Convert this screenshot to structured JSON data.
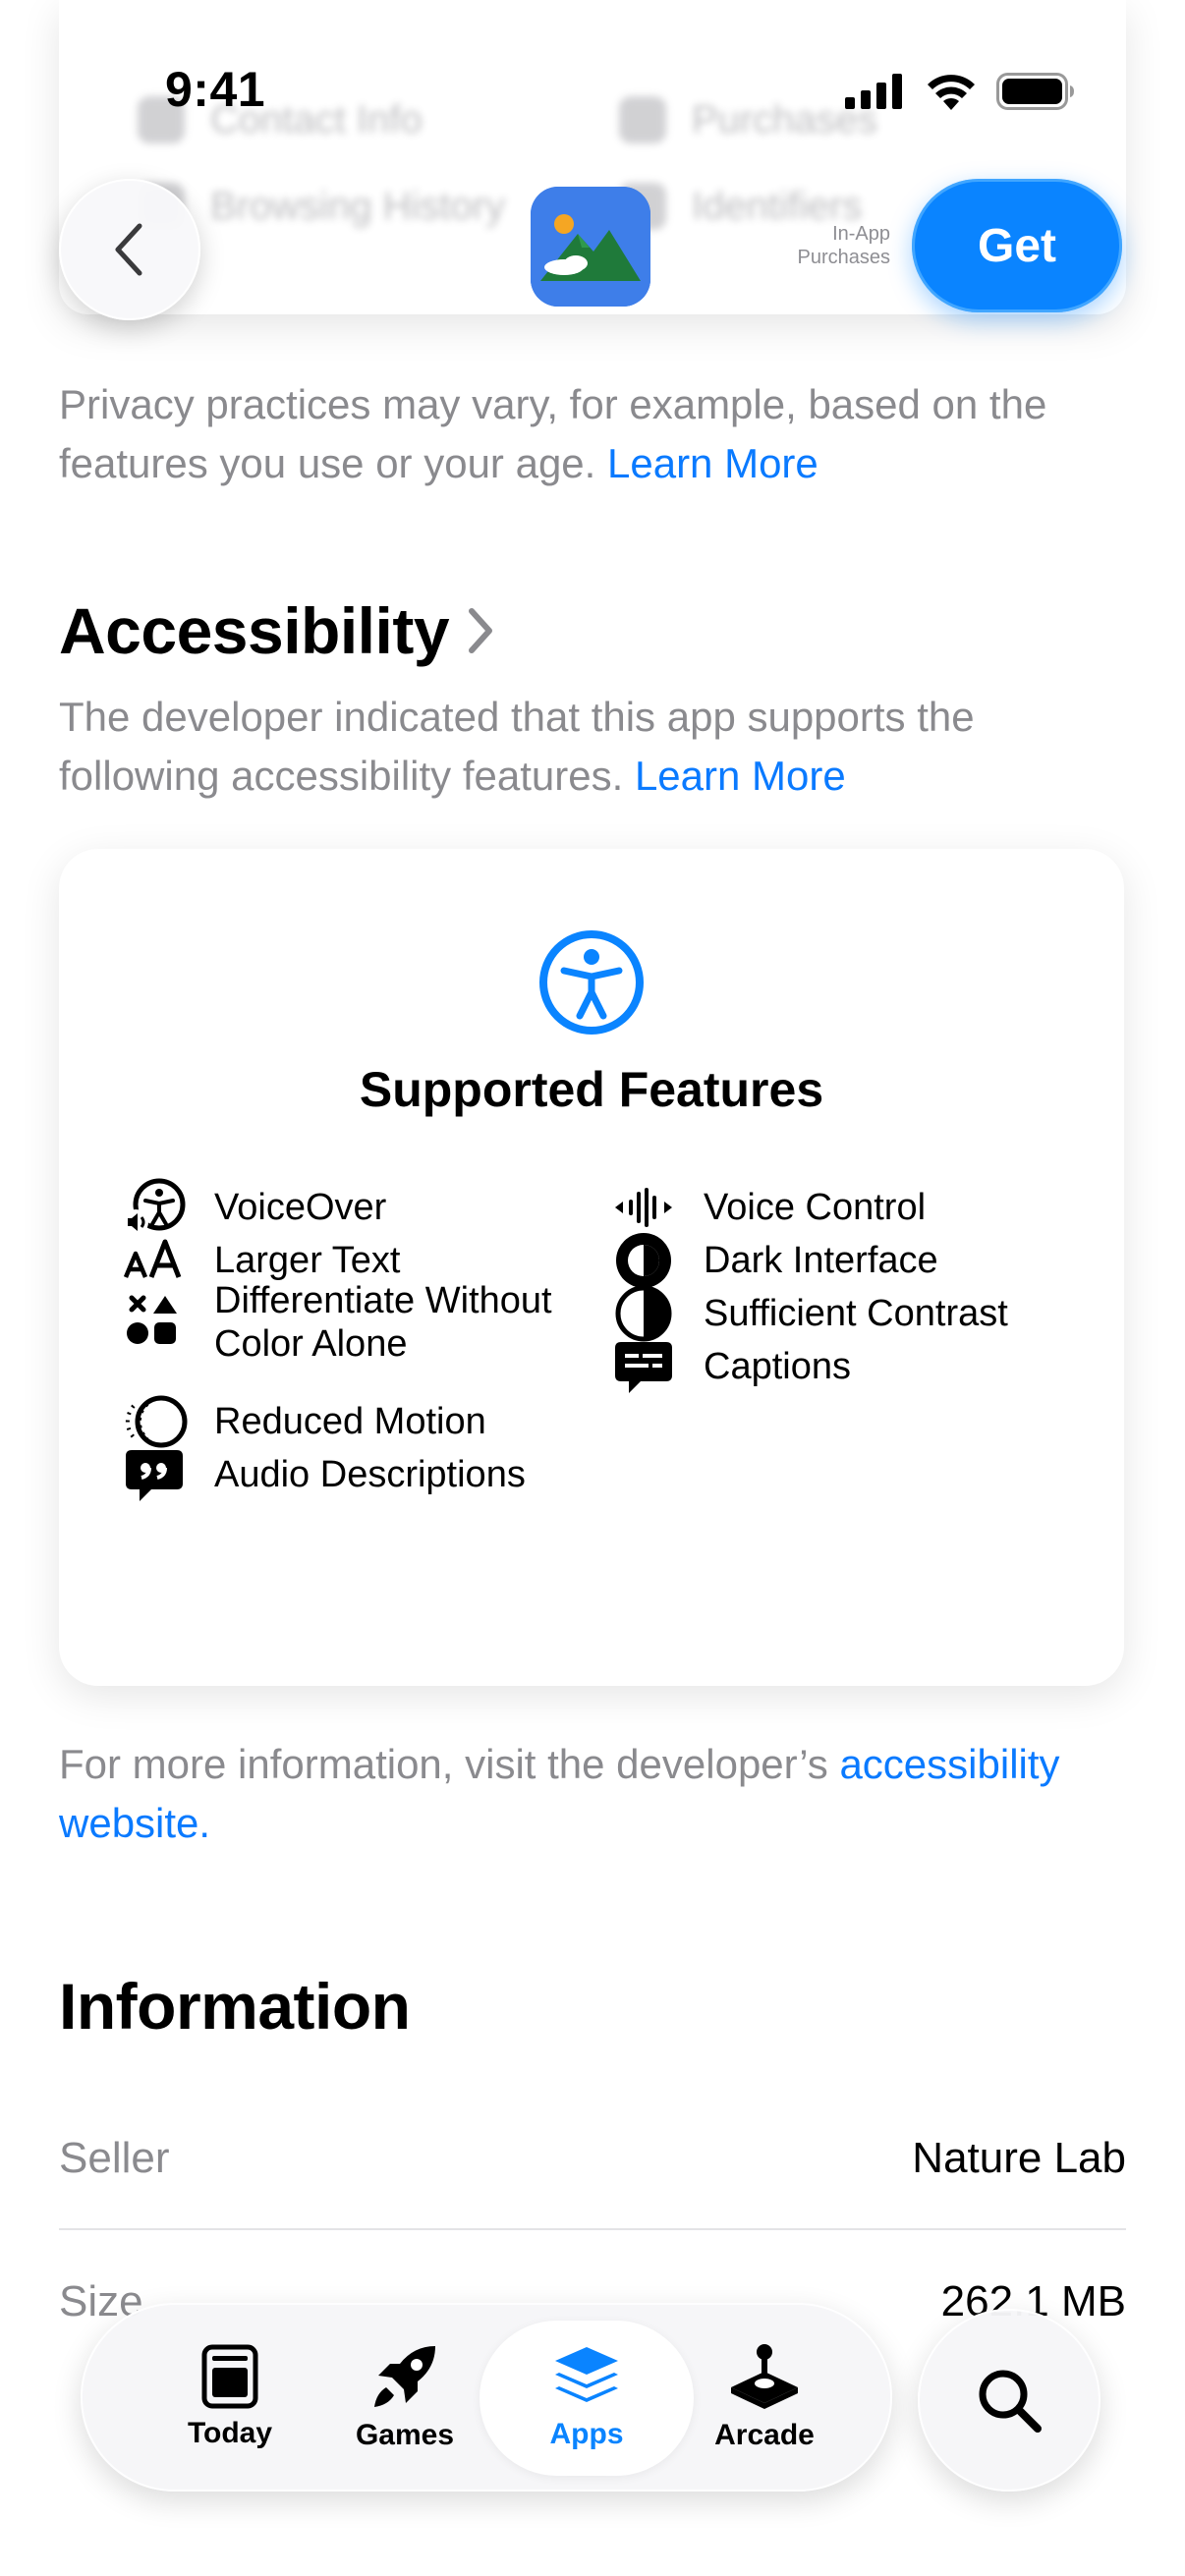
{
  "status_bar": {
    "time": "9:41"
  },
  "ghost": {
    "items": [
      "Contact Info",
      "Purchases",
      "Browsing History",
      "Identifiers"
    ]
  },
  "header": {
    "in_app_line1": "In-App",
    "in_app_line2": "Purchases",
    "get_label": "Get",
    "back_icon": "chevron-left-icon"
  },
  "privacy": {
    "text": "Privacy practices may vary, for example, based on the features you use or your age. ",
    "learn_more": "Learn More"
  },
  "accessibility": {
    "title": "Accessibility",
    "description": "The developer indicated that this app supports the following accessibility features. ",
    "learn_more": "Learn More",
    "card_title": "Supported Features",
    "features_left": [
      {
        "label": "VoiceOver",
        "icon": "voiceover-icon"
      },
      {
        "label": "Larger Text",
        "icon": "larger-text-icon"
      },
      {
        "label": "Differentiate Without Color Alone",
        "icon": "differentiate-color-icon"
      },
      {
        "label": "Reduced Motion",
        "icon": "reduced-motion-icon"
      },
      {
        "label": "Audio Descriptions",
        "icon": "audio-descriptions-icon"
      }
    ],
    "features_right": [
      {
        "label": "Voice Control",
        "icon": "voice-control-icon"
      },
      {
        "label": "Dark Interface",
        "icon": "dark-interface-icon"
      },
      {
        "label": "Sufficient Contrast",
        "icon": "sufficient-contrast-icon"
      },
      {
        "label": "Captions",
        "icon": "captions-icon"
      }
    ],
    "more_info_text": "For more information, visit the developer’s ",
    "website_link": "accessibility website."
  },
  "information": {
    "title": "Information",
    "rows": [
      {
        "key": "Seller",
        "value": "Nature Lab"
      },
      {
        "key": "Size",
        "value": "262.1 MB"
      }
    ]
  },
  "tab_bar": {
    "tabs": [
      {
        "label": "Today",
        "icon": "today-icon",
        "active": false
      },
      {
        "label": "Games",
        "icon": "rocket-icon",
        "active": false
      },
      {
        "label": "Apps",
        "icon": "apps-stack-icon",
        "active": true
      },
      {
        "label": "Arcade",
        "icon": "joystick-icon",
        "active": false
      }
    ],
    "search_icon": "search-icon"
  },
  "colors": {
    "accent": "#0a84ff",
    "link": "#0a7aff",
    "secondary_text": "#8a8a8e"
  }
}
